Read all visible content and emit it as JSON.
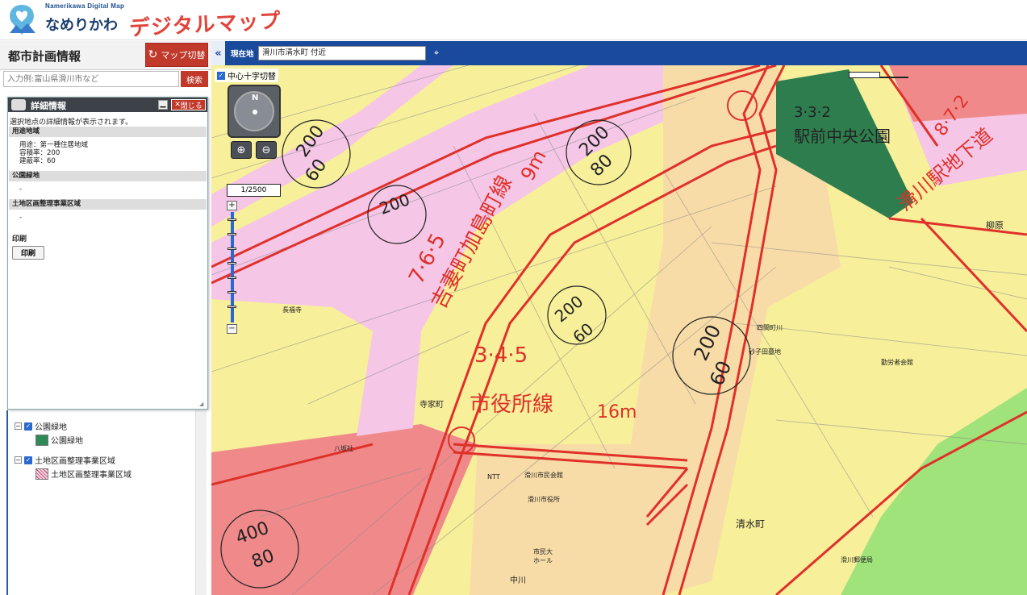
{
  "header": {
    "logo_sub": "Namerikawa Digital Map",
    "logo_name": "なめりかわ",
    "logo_title": "デジタルマップ"
  },
  "panel": {
    "title": "都市計画情報",
    "map_switch_label": "マップ切替",
    "search_placeholder": "入力例:富山県滑川市など",
    "search_label": "検索"
  },
  "detail": {
    "title": "詳細情報",
    "close_label": "閉じる",
    "description": "選択地点の詳細情報が表示されます。",
    "sections": [
      {
        "head": "用途地域",
        "lines": [
          "用途：第一種住居地域",
          "容積率：200",
          "建蔽率：60"
        ]
      },
      {
        "head": "公園緑地",
        "lines": [
          "-"
        ]
      },
      {
        "head": "土地区画整理事業区域",
        "lines": [
          "-"
        ]
      }
    ],
    "print_section": "印刷",
    "print_button": "印刷"
  },
  "layer_tree": {
    "items": [
      {
        "label": "公園緑地",
        "level": 0,
        "checked": true
      },
      {
        "label": "公園緑地",
        "level": 1,
        "swatch": "#2e8b57"
      },
      {
        "label": "土地区画整理事業区域",
        "level": 0,
        "checked": true
      },
      {
        "label": "土地区画整理事業区域",
        "level": 1,
        "swatch": "hatched"
      }
    ]
  },
  "location_bar": {
    "label": "現在地",
    "value": "滑川市清水町 付近"
  },
  "map": {
    "crosshair_label": "中心十字切替",
    "nav_north": "N",
    "scale": "1/2500",
    "route_labels": {
      "sakae_route": "吉妻町加島町線",
      "sakae_width": "9m",
      "route_id_1": "7·6·5",
      "route_id_2": "3·4·5",
      "city_hall_route": "市役所線",
      "city_hall_width": "16m",
      "park_id": "3·3·2",
      "park_name": "駅前中央公園",
      "station_route_id": "8·7·2",
      "station_route": "滑川駅地下道"
    },
    "zone_badges": [
      {
        "far": "200",
        "bcr": "60"
      },
      {
        "far": "200",
        "bcr": "80"
      },
      {
        "far": "200",
        "bcr": "60"
      },
      {
        "far": "200",
        "bcr": "60"
      },
      {
        "far": "200",
        "bcr": "60"
      },
      {
        "far": "400",
        "bcr": "80"
      }
    ],
    "place_labels": [
      "滑川市民会館",
      "滑川市役所",
      "市民大ホール",
      "NTT",
      "清水町",
      "四間町川",
      "砂子田墓地",
      "長福寺",
      "寺家町",
      "八坂社",
      "柳原",
      "勤労者会館",
      "中川",
      "滑川郵便局"
    ],
    "colors": {
      "zone_yellow": "#f7ef9a",
      "zone_pink": "#f5c6e6",
      "zone_orange": "#f8dca8",
      "zone_red": "#f08a8a",
      "zone_green": "#9fe37a",
      "park_green": "#2e7d4f",
      "route_red": "#e0302a",
      "accent_blue": "#1a4a9c"
    }
  }
}
